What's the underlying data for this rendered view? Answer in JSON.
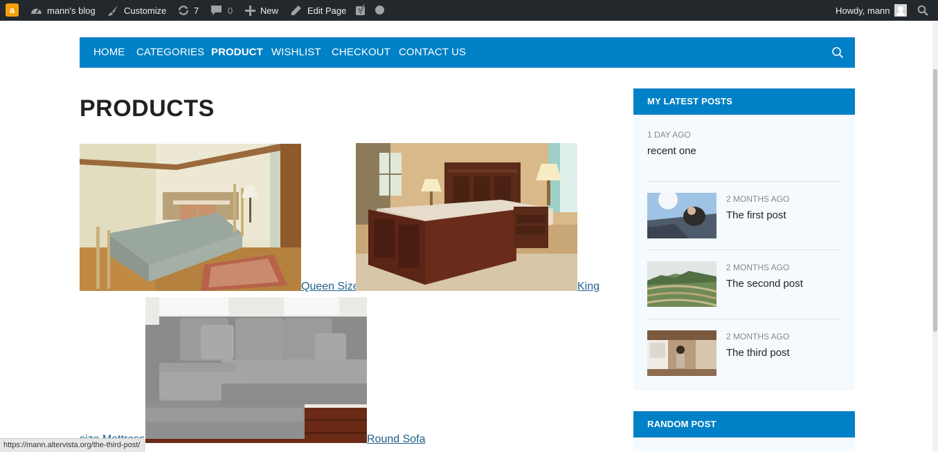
{
  "admin_bar": {
    "logo": "a",
    "site_name": "mann's blog",
    "customize": "Customize",
    "updates_count": "7",
    "comments_count": "0",
    "new_label": "New",
    "edit_page": "Edit Page",
    "greeting": "Howdy, mann"
  },
  "nav": {
    "items": [
      {
        "label": "HOME"
      },
      {
        "label": "CATEGORIES"
      },
      {
        "label": "PRODUCT"
      },
      {
        "label": "WISHLIST"
      },
      {
        "label": "CHECKOUT"
      },
      {
        "label": "CONTACT US"
      }
    ],
    "active": "PRODUCT"
  },
  "main": {
    "title": "PRODUCTS",
    "products": [
      {
        "link": "Queen Size"
      },
      {
        "link": "King"
      },
      {
        "link": "size Mattress"
      },
      {
        "link": "Round Sofa"
      }
    ]
  },
  "sidebar": {
    "latest_title": "MY LATEST POSTS",
    "posts": [
      {
        "date": "1 DAY AGO",
        "title": "recent one"
      },
      {
        "date": "2 MONTHS AGO",
        "title": "The first post"
      },
      {
        "date": "2 MONTHS AGO",
        "title": "The second post"
      },
      {
        "date": "2 MONTHS AGO",
        "title": "The third post"
      }
    ],
    "random_title": "RANDOM POST"
  },
  "status_bar": {
    "url": "https://mann.altervista.org/the-third-post/"
  },
  "colors": {
    "admin_bg": "#23282d",
    "nav_blue": "#0080c6",
    "link": "#1f5f8b",
    "sidebar_bg": "#f4fafd"
  }
}
